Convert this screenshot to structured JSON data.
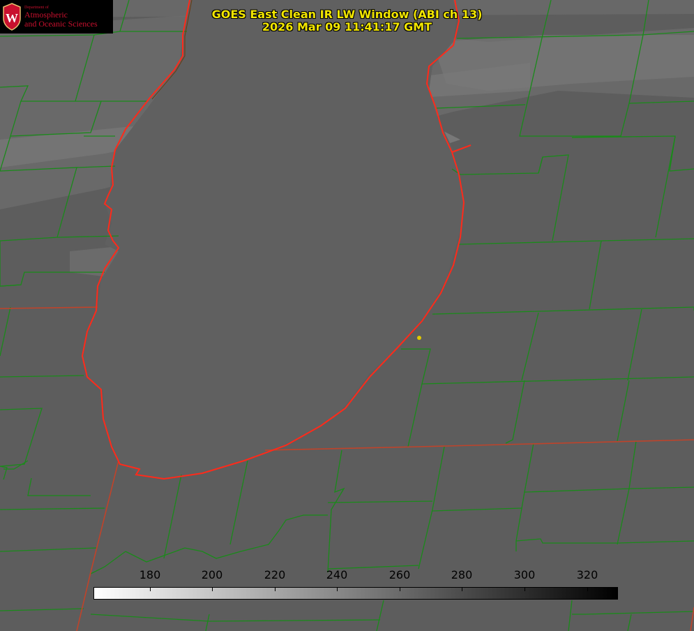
{
  "title": {
    "line1": "GOES East Clean IR LW Window (ABI ch 13)",
    "line2": "2026 Mar 09 11:41:17 GMT"
  },
  "logo": {
    "department": "Department of",
    "line1": "Atmospheric",
    "line2": "and Oceanic Sciences",
    "shield_letter": "W",
    "color": "#c8102e"
  },
  "colorbar": {
    "ticks": [
      "180",
      "200",
      "220",
      "240",
      "260",
      "280",
      "300",
      "320"
    ],
    "min_color": "#ffffff",
    "max_color": "#000000"
  },
  "colors": {
    "background": "#5c5c5c",
    "lake_shore": "#ff2a1a",
    "county_lines": "#1a8a1a",
    "title_text": "#f2e600",
    "marker": "#e0c800"
  }
}
